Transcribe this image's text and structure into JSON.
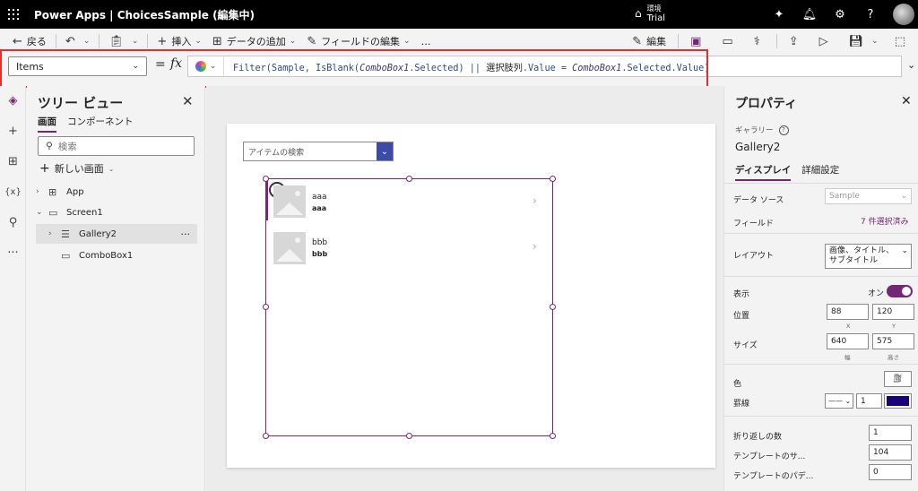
{
  "topbar": {
    "app_title": "Power Apps  |  ChoicesSample (編集中)",
    "env_label": "環境",
    "env_value": "Trial",
    "icons": [
      "copilot-icon",
      "bell-icon",
      "gear-icon",
      "help-icon"
    ]
  },
  "command_bar": {
    "back": "戻る",
    "insert": "挿入",
    "add_data": "データの追加",
    "edit_fields": "フィールドの編集",
    "more": "…",
    "edit": "編集"
  },
  "formula_bar": {
    "property": "Items",
    "equals": "=",
    "fx": "fx",
    "formula_parts": {
      "p1": "Filter(Sample, IsBlank(",
      "p2": "ComboBox1",
      "p3": ".Selected) || ",
      "p4": "選択肢列",
      "p5": ".Value = ",
      "p6": "ComboBox1",
      "p7": ".Selected.Value)"
    }
  },
  "tree_view": {
    "title": "ツリー ビュー",
    "tabs": [
      "画面",
      "コンポーネント"
    ],
    "search_placeholder": "検索",
    "new_screen": "新しい画面",
    "nodes": [
      "App",
      "Screen1",
      "Gallery2",
      "ComboBox1"
    ],
    "more": "···"
  },
  "canvas": {
    "combo_placeholder": "アイテムの検索",
    "gallery_items": [
      {
        "title": "aaa",
        "subtitle": "aaa"
      },
      {
        "title": "bbb",
        "subtitle": "bbb"
      }
    ]
  },
  "properties": {
    "title": "プロパティ",
    "kind": "ギャラリー",
    "name": "Gallery2",
    "tabs": [
      "ディスプレイ",
      "詳細設定"
    ],
    "data_source_label": "データ ソース",
    "data_source_value": "Sample",
    "fields_label": "フィールド",
    "fields_value": "7 件選択済み",
    "layout_label": "レイアウト",
    "layout_value": "画像、タイトル、サブタイトル",
    "visible_label": "表示",
    "visible_value": "オン",
    "position_label": "位置",
    "x": "88",
    "y": "120",
    "x_cap": "X",
    "y_cap": "Y",
    "size_label": "サイズ",
    "width": "640",
    "height": "575",
    "width_cap": "幅",
    "height_cap": "高さ",
    "color_label": "色",
    "border_label": "罫線",
    "border_width": "1",
    "border_color": "#1a007a",
    "wrap_label": "折り返しの数",
    "wrap_value": "1",
    "template_size_label": "テンプレートのサ...",
    "template_size_value": "104",
    "template_padding_label": "テンプレートのパデ...",
    "template_padding_value": "0"
  },
  "colors": {
    "accent": "#742774",
    "combo_button": "#3c4ba8",
    "highlight": "#e03030"
  }
}
